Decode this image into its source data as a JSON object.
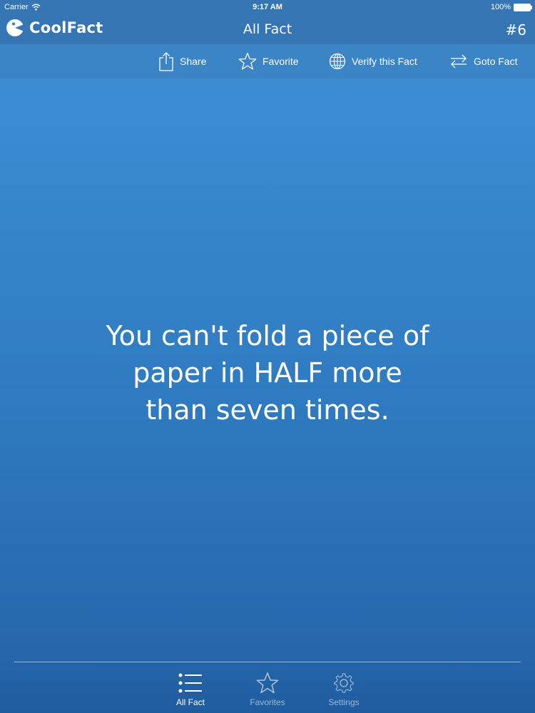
{
  "status_bar": {
    "carrier": "Carrier",
    "time": "9:17 AM",
    "battery": "100%"
  },
  "app": {
    "name": "CoolFact",
    "title": "All Fact",
    "fact_number": "#6"
  },
  "toolbar": {
    "share": "Share",
    "favorite": "Favorite",
    "verify": "Verify this Fact",
    "goto": "Goto Fact"
  },
  "fact": {
    "lines": [
      "You can't fold a piece of",
      "paper in HALF more",
      "than seven times."
    ]
  },
  "tabs": [
    {
      "label": "All Fact",
      "icon": "list-icon",
      "selected": true
    },
    {
      "label": "Favorites",
      "icon": "star-icon",
      "selected": false
    },
    {
      "label": "Settings",
      "icon": "gear-icon",
      "selected": false
    }
  ]
}
